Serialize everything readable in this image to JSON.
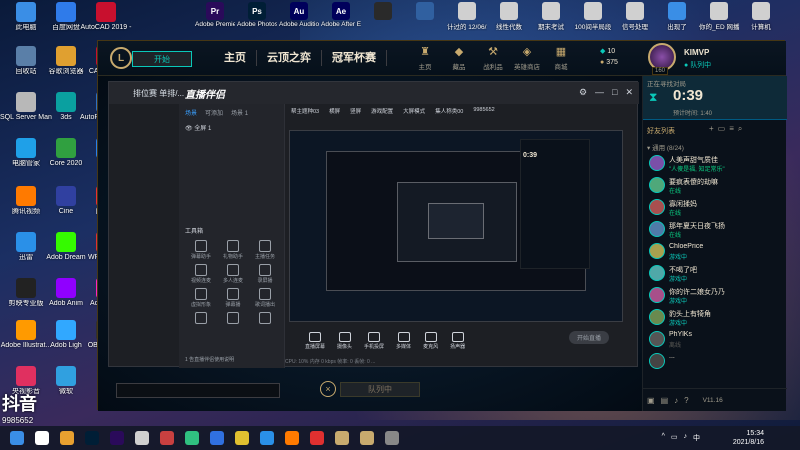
{
  "desktop": {
    "left_icons": [
      {
        "label": "此电脑",
        "color": "#3a8ee6"
      },
      {
        "label": "百度网盘",
        "color": "#2f7bea"
      },
      {
        "label": "AutoCAD 2019 -",
        "color": "#c8102e"
      },
      {
        "label": "回收站",
        "color": "#5a7fa8"
      },
      {
        "label": "谷歌浏览器",
        "color": "#e0a030"
      },
      {
        "label": "CAD_2019",
        "color": "#c8102e"
      },
      {
        "label": "SQL Server Managem...",
        "color": "#b8b8b8"
      },
      {
        "label": "3ds",
        "color": "#0aa0a0"
      },
      {
        "label": "AutoPlk 桌面管理",
        "color": "#3070c0"
      },
      {
        "label": "电脑管家",
        "color": "#1fa0e8"
      },
      {
        "label": "Core 2020",
        "color": "#30a040"
      },
      {
        "label": "钉钉",
        "color": "#2a7fe8"
      },
      {
        "label": "腾讯视频",
        "color": "#ff7a00"
      },
      {
        "label": "Cine",
        "color": "#3040a0"
      },
      {
        "label": "向日葵",
        "color": "#e83030"
      },
      {
        "label": "迅雷",
        "color": "#2a90e8"
      },
      {
        "label": "Adob Dream",
        "color": "#35fa00"
      },
      {
        "label": "WPS Office",
        "color": "#e03030"
      },
      {
        "label": "剪映专业版",
        "color": "#222222"
      },
      {
        "label": "Adob Anim",
        "color": "#9000ff"
      },
      {
        "label": "Adobe XD",
        "color": "#ff26be"
      },
      {
        "label": "Adobe Illustrat...",
        "color": "#ff9a00"
      },
      {
        "label": "Adob Ligh",
        "color": "#31a8ff"
      },
      {
        "label": "OBS Studio",
        "color": "#303030"
      },
      {
        "label": "央视影音",
        "color": "#e03060"
      },
      {
        "label": "微软",
        "color": "#30a0e0"
      }
    ],
    "top_icons": [
      {
        "label": "Adobe Premie...",
        "color": "#2a0a5a",
        "glyph": "Pr"
      },
      {
        "label": "Adobe Photosh...",
        "color": "#001e36",
        "glyph": "Ps"
      },
      {
        "label": "Adobe Audition...",
        "color": "#00005b",
        "glyph": "Au"
      },
      {
        "label": "Adobe After Effects 2020",
        "color": "#00005b",
        "glyph": "Ae"
      },
      {
        "label": "",
        "color": "#2a2a2a",
        "glyph": ""
      },
      {
        "label": "",
        "color": "#3060a0",
        "glyph": ""
      },
      {
        "label": "计过的 12/06/11",
        "color": "#d0d0d0",
        "glyph": ""
      },
      {
        "label": "线性代数",
        "color": "#d0d0d0",
        "glyph": ""
      },
      {
        "label": "期末考试",
        "color": "#d0d0d0",
        "glyph": ""
      },
      {
        "label": "100间半局段",
        "color": "#d0d0d0",
        "glyph": ""
      },
      {
        "label": "信号处理",
        "color": "#d0d0d0",
        "glyph": ""
      },
      {
        "label": "出现了",
        "color": "#3a8ee6",
        "glyph": ""
      },
      {
        "label": "你的_ED 网播",
        "color": "#d0d0d0",
        "glyph": ""
      },
      {
        "label": "计算机",
        "color": "#d0d0d0",
        "glyph": ""
      }
    ]
  },
  "lol": {
    "play_label": "开始",
    "nav": [
      "主页",
      "云顶之弈",
      "冠军杯赛"
    ],
    "nav_icons": [
      {
        "label": "主页",
        "glyph": "♜"
      },
      {
        "label": "藏品",
        "glyph": "◆"
      },
      {
        "label": "战利品",
        "glyph": "⚒"
      },
      {
        "label": "英雄商店",
        "glyph": "◈"
      },
      {
        "label": "商城",
        "glyph": "▦"
      }
    ],
    "currency": {
      "be": "10",
      "rp": "375"
    },
    "profile": {
      "name": "KIMVP",
      "status": "队列中",
      "level": "160"
    },
    "queue": {
      "cancel": "×",
      "label": "队列中"
    },
    "social": {
      "queue_title": "正在寻找对局",
      "queue_time": "0:39",
      "queue_sub": "预计时间: 1:40",
      "friends_header": "好友列表",
      "group": "通用 (8/24)",
      "friends": [
        {
          "name": "人美声甜气质佳",
          "status": "\"人傻是福, 知足常乐\"",
          "type": "online"
        },
        {
          "name": "要疯表傻的劫嘛",
          "status": "在线",
          "type": "online"
        },
        {
          "name": "寡闲揉妈",
          "status": "在线",
          "type": "online"
        },
        {
          "name": "那年夏天日夜飞扬",
          "status": "在线",
          "type": "online"
        },
        {
          "name": "ChloePrice",
          "status": "游戏中",
          "type": "game"
        },
        {
          "name": "不喝了吧",
          "status": "游戏中",
          "type": "game"
        },
        {
          "name": "你的许二娘女乃乃",
          "status": "游戏中",
          "type": "game"
        },
        {
          "name": "豹头上有犄角",
          "status": "游戏中",
          "type": "game"
        },
        {
          "name": "PhYlKs",
          "status": "离线",
          "type": "offline"
        },
        {
          "name": "...",
          "status": "",
          "type": "offline"
        }
      ],
      "version": "V11.16"
    }
  },
  "stream_app": {
    "queue_text": "排位赛 单排/...",
    "brand": "直播伴侣",
    "tabs": [
      "场景",
      "可添加",
      "场景 1"
    ],
    "scene_name": "全屏 1",
    "tools_header": "工具箱",
    "tools": [
      "弹幕助手",
      "礼物助手",
      "主播任务",
      "视频连麦",
      "多人连麦",
      "录屏播",
      "虚拟形象",
      "弹幕播",
      "歌词播出",
      "",
      "",
      ""
    ],
    "toolbar": [
      "帮主题种03",
      "横屏",
      "竖屏",
      "游戏配置",
      "大屏模式",
      "集人称类00",
      "9985652"
    ],
    "controls": [
      "直播屏幕",
      "摄像头",
      "手机投屏",
      "多媒体",
      "麦克风",
      "扬声器"
    ],
    "live_button": "开始直播",
    "room_text": "1 告直播伴侣使用说明",
    "status_bar": "CPU: 10%  内存  0 kbps  帧率: 0  丢帧: 0  ..."
  },
  "watermark": {
    "logo": "抖音",
    "id": "9985652"
  },
  "taskbar": {
    "time": "15:34",
    "date": "2021/8/16",
    "ime": "中"
  }
}
